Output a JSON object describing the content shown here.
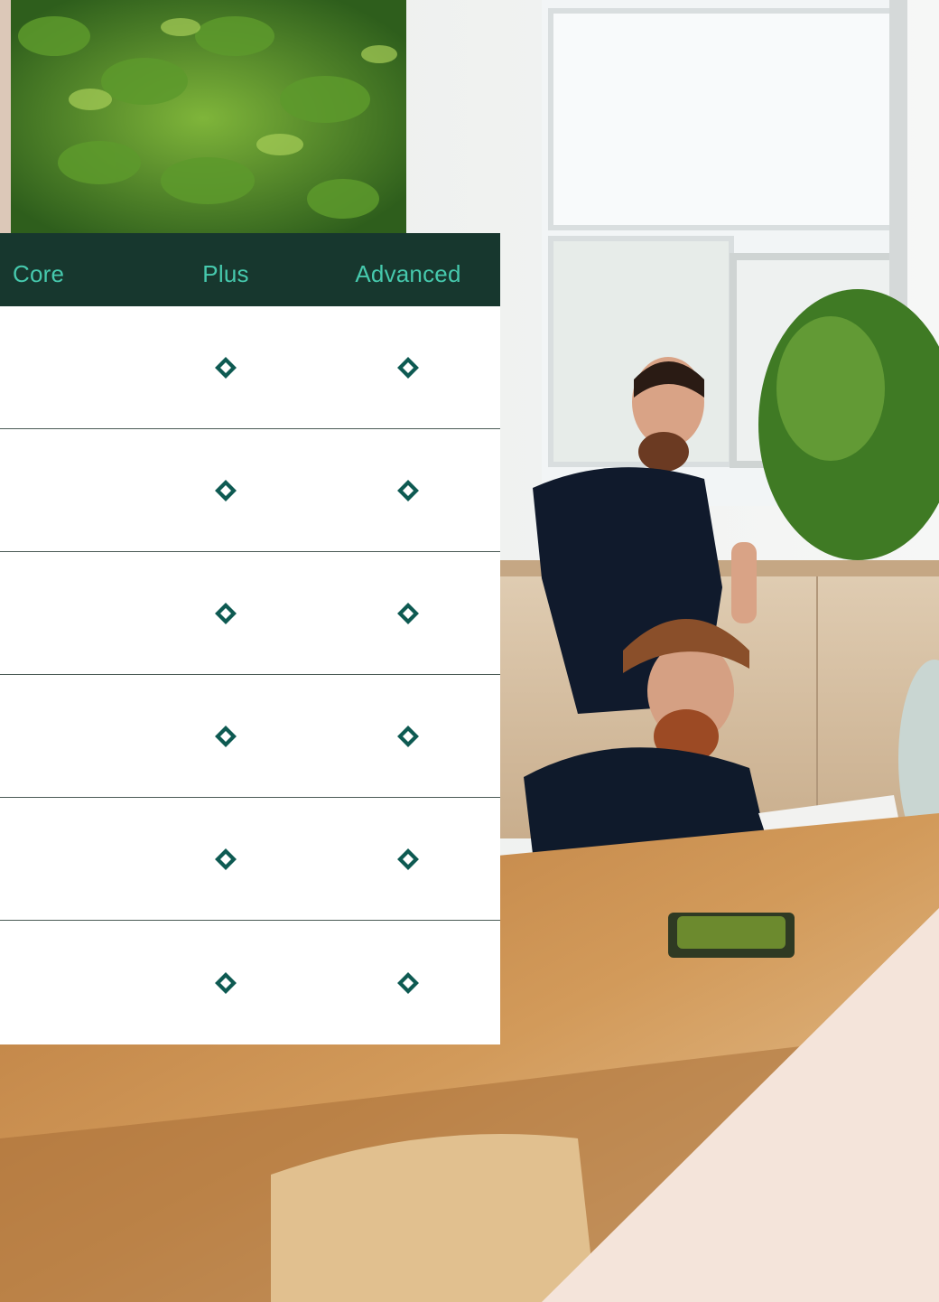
{
  "colors": {
    "header_bg": "#17372e",
    "header_text": "#46c9ad",
    "check_icon": "#0e5a52",
    "row_divider": "#4a5a55",
    "peach_accent": "#f4e4da"
  },
  "table": {
    "columns": [
      {
        "label": "Core"
      },
      {
        "label": "Plus"
      },
      {
        "label": "Advanced"
      }
    ],
    "rows": [
      {
        "core": false,
        "plus": true,
        "advanced": true
      },
      {
        "core": false,
        "plus": true,
        "advanced": true
      },
      {
        "core": false,
        "plus": true,
        "advanced": true
      },
      {
        "core": false,
        "plus": true,
        "advanced": true
      },
      {
        "core": false,
        "plus": true,
        "advanced": true
      },
      {
        "core": false,
        "plus": true,
        "advanced": true
      }
    ],
    "check_icon_name": "diamond-check-icon"
  },
  "background": {
    "subject": "office-photo"
  }
}
